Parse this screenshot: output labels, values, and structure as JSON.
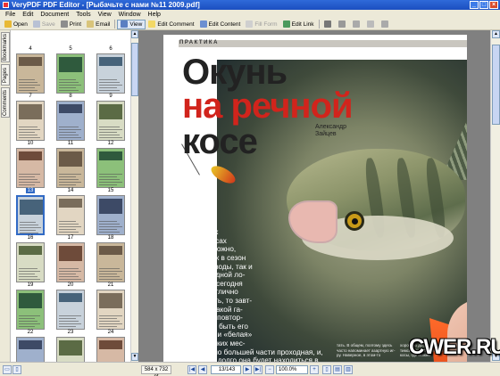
{
  "window": {
    "title": "VeryPDF PDF Editor - [Рыбачьте с нами №11 2009.pdf]",
    "controls": [
      "_",
      "□",
      "×"
    ]
  },
  "menu": [
    "File",
    "Edit",
    "Document",
    "Tools",
    "View",
    "Window",
    "Help"
  ],
  "toolbar": {
    "open": "Open",
    "save": "Save",
    "print": "Print",
    "email": "Email",
    "view": "View",
    "edit_comment": "Edit Comment",
    "edit_content": "Edit Content",
    "fill_form": "Fill Form",
    "edit_link": "Edit Link"
  },
  "side_tabs": [
    "Bookmarks",
    "Pages",
    "Comments"
  ],
  "thumbnails": {
    "selected_page": "13",
    "pages": [
      "4",
      "5",
      "6",
      "7",
      "8",
      "9",
      "10",
      "11",
      "12",
      "13",
      "14",
      "15",
      "16",
      "17",
      "18",
      "19",
      "20",
      "21",
      "22",
      "23",
      "24"
    ]
  },
  "article": {
    "section": "ПРАКТИКА",
    "title_line1": "Окунь",
    "title_line2": "на речной",
    "title_line3": "косе",
    "author_first": "Александр",
    "author_last": "Зайцев",
    "body": "Исход ры-\nбалки на\nподводных\nречных косах\nугадать сложно,\nпричем как в сезон\nоткрытой воды, так и\nпри подледной ло-\nвле. Если сегодня\nудалось отлично\nпорыбачить, то завт-\nра нет никакой га-\nрантии на повтор-\nную удачу, быть его\nхищная или «белая»\nрыба. В таких мес-\nтах рыба по большей части проходная, и,\nнасколько долго она будет находиться в",
    "small_col1": "тать. В общем, поэтому здесь\nчасто напоминает азартную иг-\nру. Наверное, в этом-то",
    "small_col2": "хорошую добычу. Спус-\nтимся с перспективной\nкосы, где можно"
  },
  "status": {
    "page_size": "584 x 732 pt",
    "page_indicator": "13/143",
    "zoom": "100.0%"
  },
  "watermark": "CWER.RU"
}
